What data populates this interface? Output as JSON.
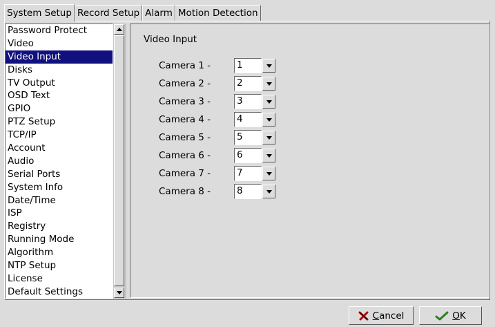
{
  "tabs": [
    {
      "label": "System Setup",
      "active": true
    },
    {
      "label": "Record Setup",
      "active": false
    },
    {
      "label": "Alarm",
      "active": false
    },
    {
      "label": "Motion Detection",
      "active": false
    }
  ],
  "sidebar": {
    "selected": "Video Input",
    "items": [
      "Password Protect",
      "Video",
      "Video Input",
      "Disks",
      "TV Output",
      "OSD Text",
      "GPIO",
      "PTZ Setup",
      "TCP/IP",
      "Account",
      "Audio",
      "Serial Ports",
      "System Info",
      "Date/Time",
      "ISP",
      "Registry",
      "Running Mode",
      "Algorithm",
      "NTP Setup",
      "License",
      "Default Settings"
    ]
  },
  "panel": {
    "title": "Video Input",
    "cameras": [
      {
        "label": "Camera 1 -",
        "value": "1"
      },
      {
        "label": "Camera 2 -",
        "value": "2"
      },
      {
        "label": "Camera 3 -",
        "value": "3"
      },
      {
        "label": "Camera 4 -",
        "value": "4"
      },
      {
        "label": "Camera 5 -",
        "value": "5"
      },
      {
        "label": "Camera 6 -",
        "value": "6"
      },
      {
        "label": "Camera 7 -",
        "value": "7"
      },
      {
        "label": "Camera 8 -",
        "value": "8"
      }
    ]
  },
  "buttons": {
    "cancel_mnemonic": "C",
    "cancel_rest": "ancel",
    "ok_mnemonic": "O",
    "ok_rest": "K",
    "cancel_icon": "x-mark-icon",
    "ok_icon": "checkmark-icon"
  },
  "colors": {
    "selection": "#10107e",
    "window": "#dcdcdc"
  }
}
